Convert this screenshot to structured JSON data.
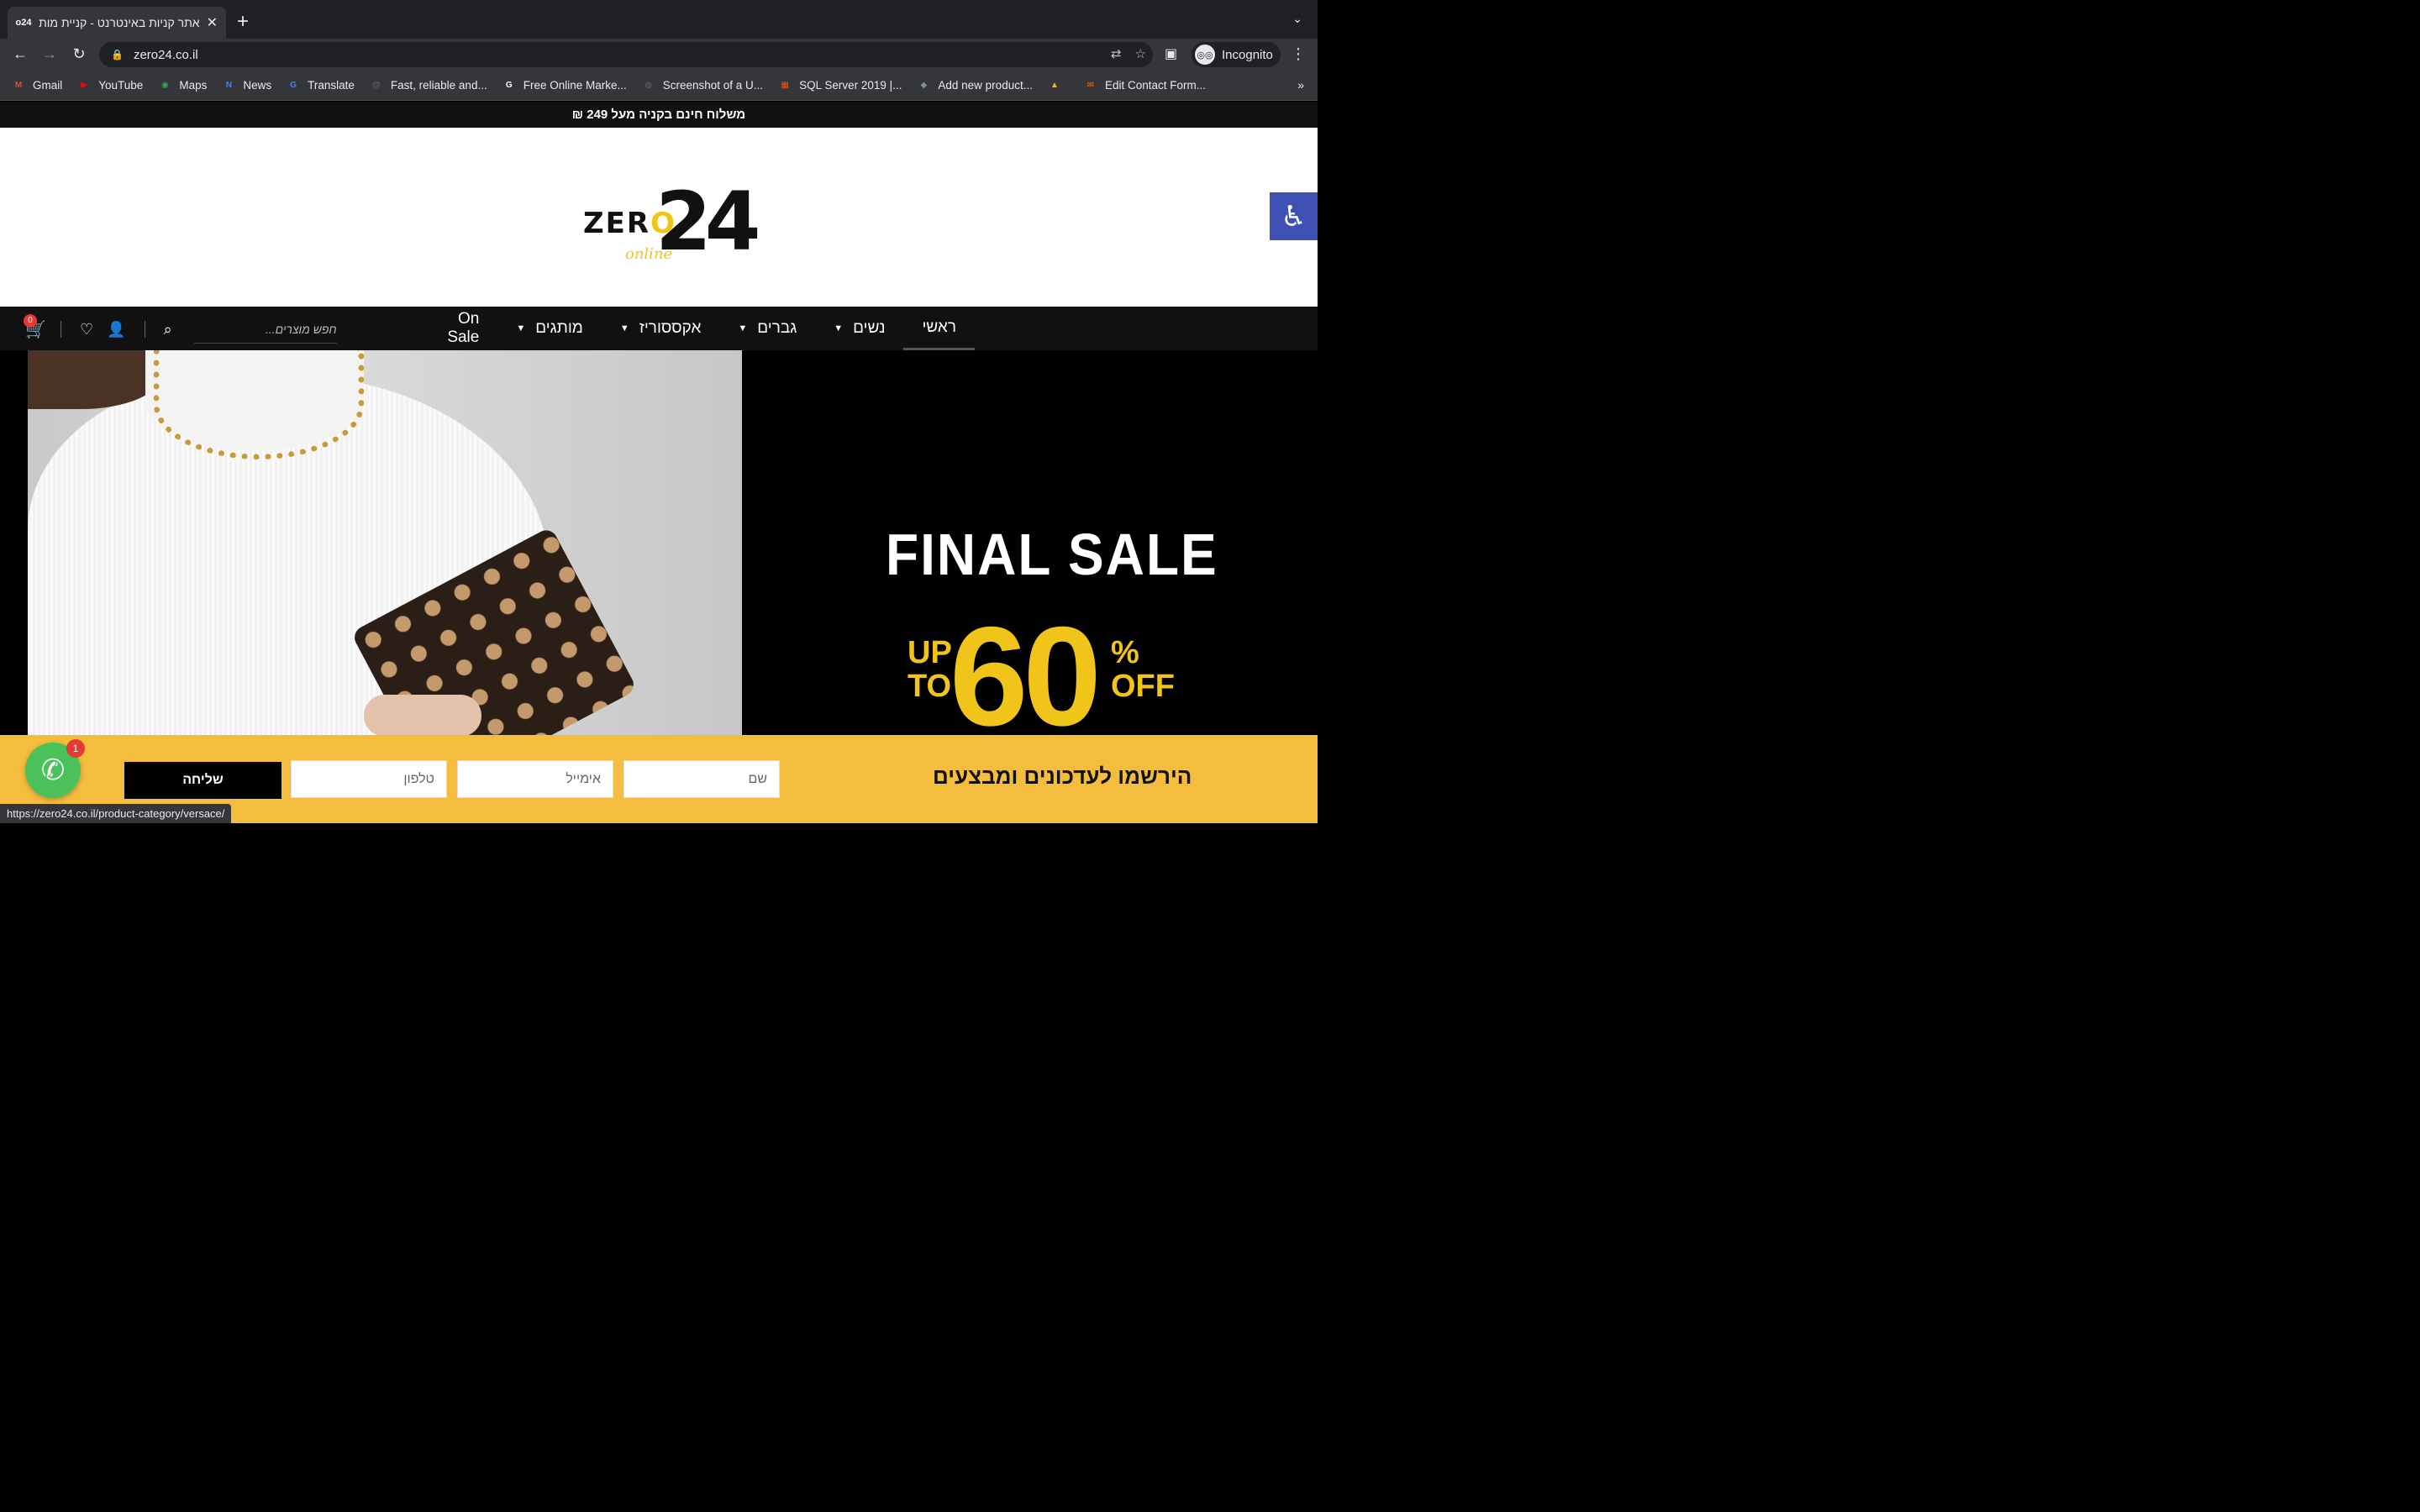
{
  "browser": {
    "tab_title": "אתר קניות באינטרנט - קניית מות",
    "favicon": "o24",
    "url": "zero24.co.il",
    "profile": "Incognito",
    "status_url": "https://zero24.co.il/product-category/versace/",
    "bookmarks": [
      {
        "label": "Gmail",
        "icon": "gmail-icon",
        "color": "#ea4335",
        "glyph": "M"
      },
      {
        "label": "YouTube",
        "icon": "youtube-icon",
        "color": "#ff0000",
        "glyph": "▶"
      },
      {
        "label": "Maps",
        "icon": "maps-icon",
        "color": "#34a853",
        "glyph": "◉"
      },
      {
        "label": "News",
        "icon": "news-icon",
        "color": "#4285f4",
        "glyph": "N"
      },
      {
        "label": "Translate",
        "icon": "translate-icon",
        "color": "#4285f4",
        "glyph": "G"
      },
      {
        "label": "Fast, reliable and...",
        "icon": "at-icon",
        "color": "#5f6368",
        "glyph": "@"
      },
      {
        "label": "Free Online Marke...",
        "icon": "google-icon",
        "color": "#ffffff",
        "glyph": "G"
      },
      {
        "label": "Screenshot of a U...",
        "icon": "globe-icon",
        "color": "#5f6368",
        "glyph": "◍"
      },
      {
        "label": "SQL Server 2019 |...",
        "icon": "microsoft-icon",
        "color": "#f25022",
        "glyph": "▦"
      },
      {
        "label": "Add new product...",
        "icon": "product-icon",
        "color": "#7b8fa8",
        "glyph": "◆"
      },
      {
        "label": "",
        "icon": "drive-icon",
        "color": "#fbbc04",
        "glyph": "▲"
      },
      {
        "label": "Edit Contact Form...",
        "icon": "form-icon",
        "color": "#e8710a",
        "glyph": "✉"
      }
    ]
  },
  "site": {
    "promo": "משלוח חינם בקניה מעל 249 ₪",
    "logo": {
      "zero": "ZERO",
      "number": "24",
      "online": "online"
    },
    "nav": [
      {
        "label": "ראשי",
        "dropdown": false,
        "active": true
      },
      {
        "label": "נשים",
        "dropdown": true
      },
      {
        "label": "גברים",
        "dropdown": true
      },
      {
        "label": "אקססוריז",
        "dropdown": true
      },
      {
        "label": "מותגים",
        "dropdown": true
      },
      {
        "label": "On Sale",
        "dropdown": false
      }
    ],
    "search_placeholder": "חפש מוצרים...",
    "cart_count": "0",
    "hero": {
      "final_sale": "FINAL SALE",
      "up": "UP",
      "to": "TO",
      "sixty": "60",
      "pct": "%",
      "off": "OFF"
    },
    "signup": {
      "heading": "הירשמו לעדכונים ומבצעים",
      "name_placeholder": "שם",
      "email_placeholder": "אימייל",
      "phone_placeholder": "טלפון",
      "submit": "שליחה"
    },
    "whatsapp_badge": "1",
    "colors": {
      "accent": "#f4bd3d",
      "accessibility": "#3f51b5",
      "whatsapp": "#4bc15a"
    }
  }
}
